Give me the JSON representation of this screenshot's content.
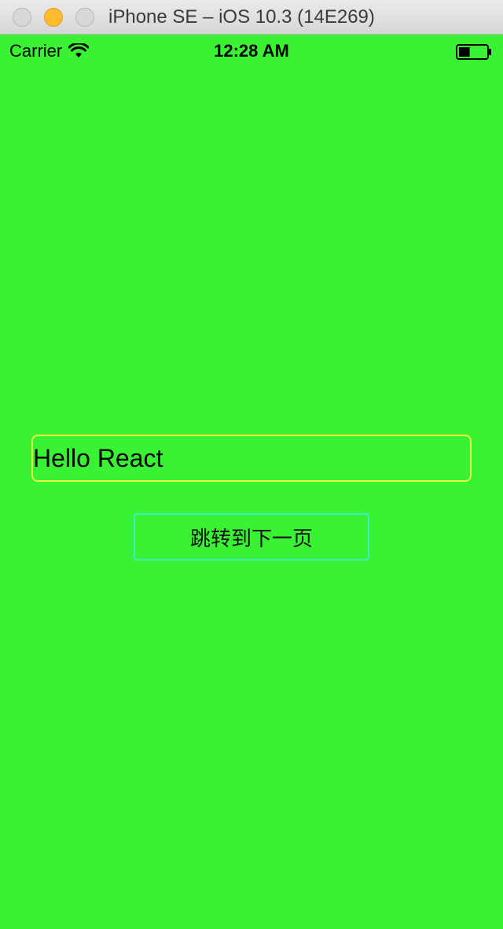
{
  "window": {
    "title": "iPhone SE – iOS 10.3 (14E269)"
  },
  "status_bar": {
    "carrier": "Carrier",
    "time": "12:28 AM",
    "battery_level": 0.4
  },
  "content": {
    "text_input_value": "Hello React",
    "next_button_label": "跳转到下一页"
  },
  "colors": {
    "background": "#39f233",
    "input_border": "#e9f43c",
    "button_border": "#3cf0c6",
    "minimize_button": "#febb2e"
  },
  "icons": {
    "wifi": "wifi-icon",
    "battery": "battery-icon"
  }
}
